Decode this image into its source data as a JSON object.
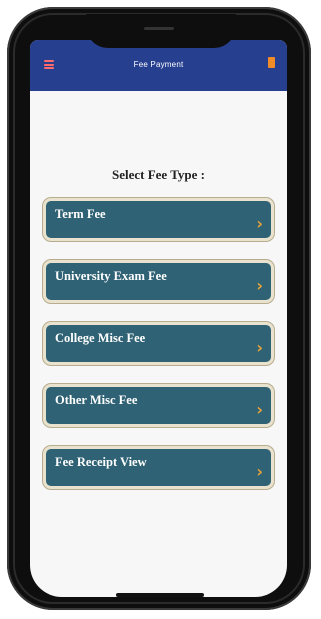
{
  "app": {
    "title": "Fee Payment",
    "colors": {
      "appbar": "#263f8f",
      "button": "#2f6274",
      "button_border": "#e8e2cf",
      "chevron": "#e8a23a",
      "menu_icon": "#ff6b6b",
      "wallet_icon": "#f28c28"
    },
    "icons": [
      "menu-icon",
      "wallet-icon",
      "chevron-right-icon"
    ]
  },
  "main": {
    "heading": "Select Fee Type :",
    "options": [
      {
        "label": "Term Fee"
      },
      {
        "label": "University Exam Fee"
      },
      {
        "label": "College Misc Fee"
      },
      {
        "label": "Other Misc Fee"
      },
      {
        "label": "Fee Receipt View"
      }
    ],
    "chevron_glyph": "›"
  }
}
